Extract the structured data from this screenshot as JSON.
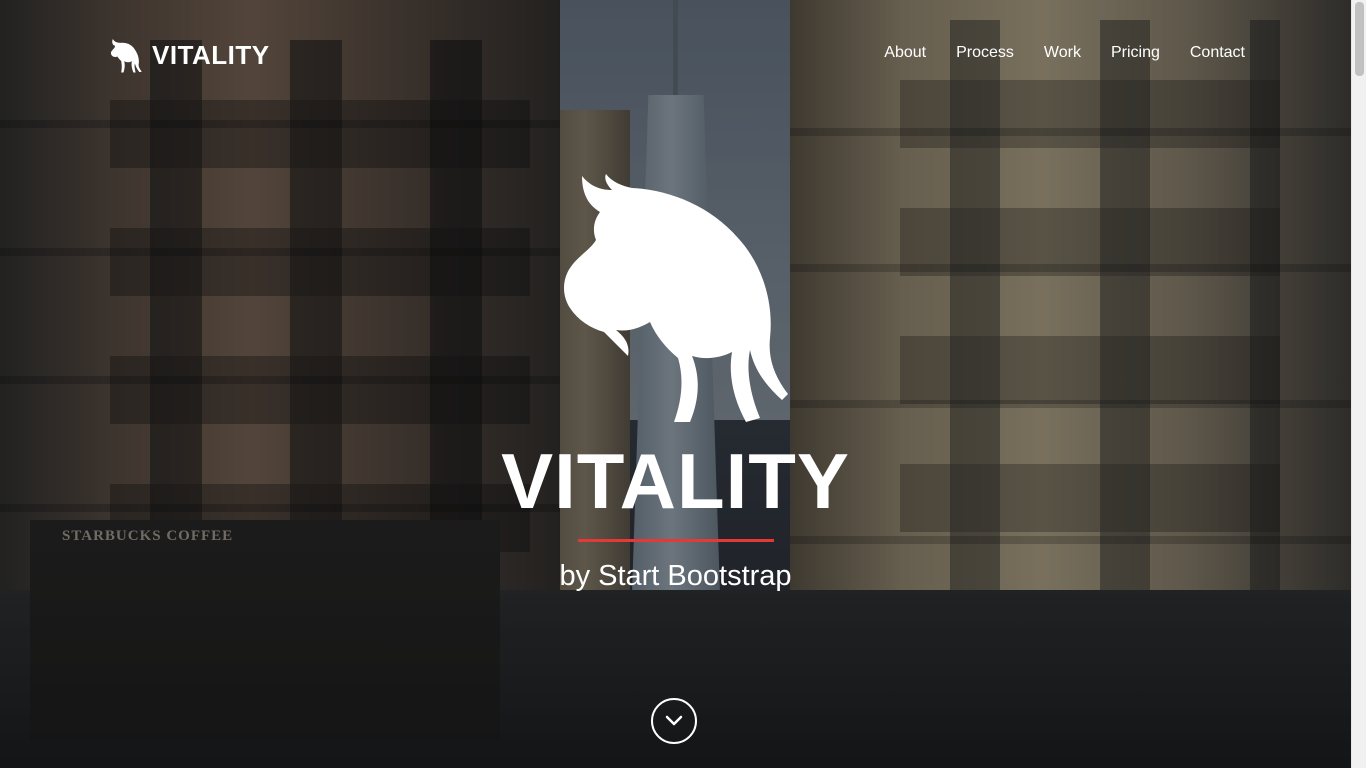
{
  "brand": {
    "name": "VITALITY",
    "icon": "bull-icon"
  },
  "nav": {
    "items": [
      {
        "label": "About"
      },
      {
        "label": "Process"
      },
      {
        "label": "Work"
      },
      {
        "label": "Pricing"
      },
      {
        "label": "Contact"
      }
    ]
  },
  "hero": {
    "title": "VITALITY",
    "subtitle": "by Start Bootstrap",
    "logo_icon": "bull-icon",
    "divider_color": "#e53935",
    "scroll_icon": "chevron-down-icon",
    "background_text": "STARBUCKS COFFEE"
  },
  "colors": {
    "text": "#ffffff",
    "accent": "#e53935"
  }
}
